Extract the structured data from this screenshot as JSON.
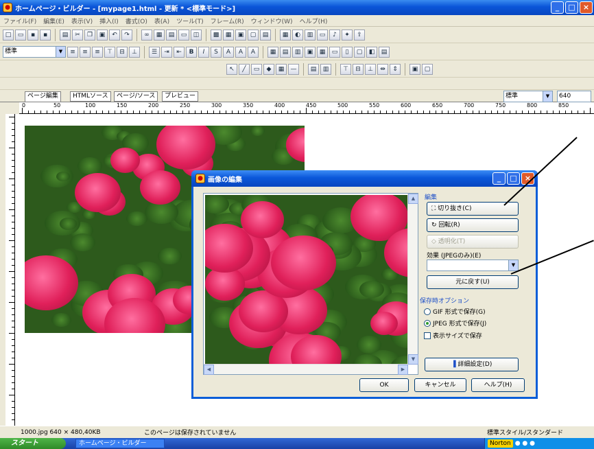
{
  "window": {
    "title": "ホームページ・ビルダー - [mypage1.html - 更新 * <標準モード>]"
  },
  "menu": [
    "ファイル(F)",
    "編集(E)",
    "表示(V)",
    "挿入(I)",
    "書式(O)",
    "表(A)",
    "ツール(T)",
    "フレーム(R)",
    "ウィンドウ(W)",
    "ヘルプ(H)"
  ],
  "format_combo": {
    "value": "標準"
  },
  "view_tabs": [
    "ページ編集",
    "HTMLソース",
    "ページ/ソース",
    "プレビュー"
  ],
  "ruler_labels": [
    "0",
    "50",
    "100",
    "150",
    "200",
    "250",
    "300",
    "350",
    "400",
    "450",
    "500",
    "550",
    "600",
    "650",
    "700",
    "750",
    "800",
    "850"
  ],
  "right_combo": {
    "value": "標準"
  },
  "right_field": {
    "value": "640"
  },
  "statusbar": {
    "file": "1000.jpg 640 × 480,40KB",
    "message": "このページは保存されていません",
    "style": "標準スタイル/スタンダード"
  },
  "taskbar": {
    "start": "スタート",
    "app": "ホームページ・ビルダー",
    "norton": "Norton"
  },
  "dialog": {
    "title": "画像の編集",
    "group_edit": "編集",
    "btn_crop": "切り抜き(C)",
    "btn_rotate": "回転(R)",
    "btn_transparent": "透明化(T)",
    "effect_label": "効果 (JPEGのみ)(E)",
    "effect_value": "",
    "btn_restore": "元に戻す(U)",
    "group_save": "保存時オプション",
    "radio_gif": "GIF 形式で保存(G)",
    "radio_jpeg": "JPEG 形式で保存(J)",
    "chk_size": "表示サイズで保存",
    "btn_detail": "詳細設定(D)",
    "btn_ok": "OK",
    "btn_cancel": "キャンセル",
    "btn_help": "ヘルプ(H)"
  },
  "icons": {
    "app": "app-icon",
    "min": "minimize-icon",
    "max": "maximize-icon",
    "close": "close-icon"
  }
}
